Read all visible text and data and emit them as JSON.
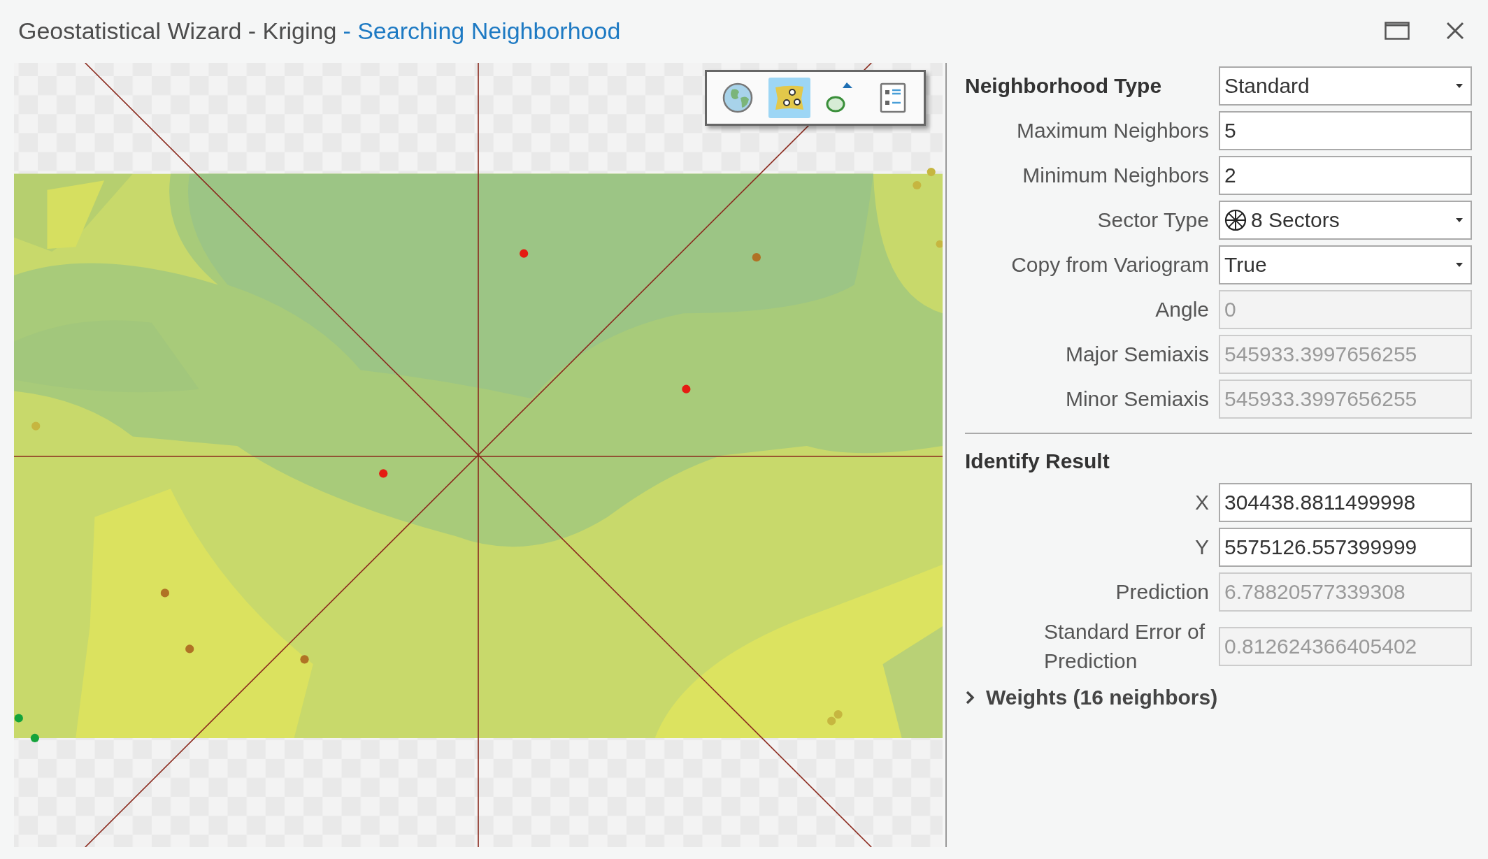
{
  "window": {
    "title": "Geostatistical Wizard - Kriging",
    "subtitle": "- Searching Neighborhood"
  },
  "map_toolbar": [
    {
      "kind": "globe",
      "selected": false
    },
    {
      "kind": "surface",
      "selected": true
    },
    {
      "kind": "ellipse",
      "selected": false
    },
    {
      "kind": "list",
      "selected": false
    }
  ],
  "neighborhood": {
    "heading": "Neighborhood Type",
    "type_value": "Standard",
    "fields": [
      {
        "label": "Maximum Neighbors",
        "kind": "text",
        "value": "5",
        "disabled": false
      },
      {
        "label": "Minimum Neighbors",
        "kind": "text",
        "value": "2",
        "disabled": false
      },
      {
        "label": "Sector Type",
        "kind": "sector-dropdown",
        "value": "8 Sectors",
        "disabled": false
      },
      {
        "label": "Copy from Variogram",
        "kind": "dropdown",
        "value": "True",
        "disabled": false
      },
      {
        "label": "Angle",
        "kind": "text",
        "value": "0",
        "disabled": true
      },
      {
        "label": "Major Semiaxis",
        "kind": "text",
        "value": "545933.3997656255",
        "disabled": true
      },
      {
        "label": "Minor Semiaxis",
        "kind": "text",
        "value": "545933.3997656255",
        "disabled": true
      }
    ]
  },
  "identify_result": {
    "heading": "Identify Result",
    "fields": [
      {
        "label": "X",
        "kind": "text",
        "value": "304438.8811499998",
        "disabled": false
      },
      {
        "label": "Y",
        "kind": "text",
        "value": "5575126.557399999",
        "disabled": false
      },
      {
        "label": "Prediction",
        "kind": "text",
        "value": "6.78820577339308",
        "disabled": true
      },
      {
        "label": "Standard Error of Prediction",
        "kind": "text",
        "value": "0.812624366405402",
        "disabled": true
      }
    ]
  },
  "weights": {
    "label": "Weights (16 neighbors)",
    "expanded": false
  }
}
